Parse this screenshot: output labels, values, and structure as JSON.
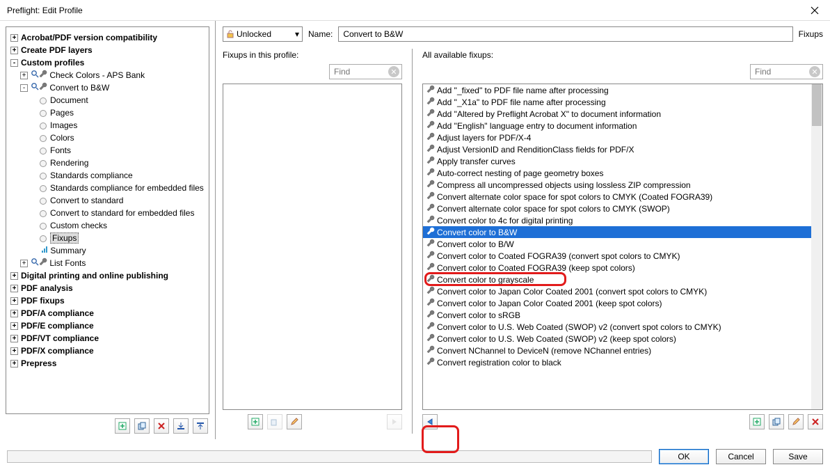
{
  "window": {
    "title": "Preflight: Edit Profile"
  },
  "tree": {
    "roots": [
      {
        "label": "Acrobat/PDF version compatibility",
        "exp": "+"
      },
      {
        "label": "Create PDF layers",
        "exp": "+"
      },
      {
        "label": "Custom profiles",
        "exp": "-",
        "children": [
          {
            "label": "Check Colors - APS Bank",
            "exp": "+",
            "type": "profile"
          },
          {
            "label": "Convert to B&W",
            "exp": "-",
            "type": "profile",
            "children": [
              {
                "label": "Document"
              },
              {
                "label": "Pages"
              },
              {
                "label": "Images"
              },
              {
                "label": "Colors"
              },
              {
                "label": "Fonts"
              },
              {
                "label": "Rendering"
              },
              {
                "label": "Standards compliance"
              },
              {
                "label": "Standards compliance for embedded files"
              },
              {
                "label": "Convert to standard"
              },
              {
                "label": "Convert to standard for embedded files"
              },
              {
                "label": "Custom checks"
              },
              {
                "label": "Fixups",
                "selected": true
              },
              {
                "label": "Summary",
                "icon": "summary"
              }
            ]
          },
          {
            "label": "List Fonts",
            "exp": "+",
            "type": "profile"
          }
        ]
      },
      {
        "label": "Digital printing and online publishing",
        "exp": "+"
      },
      {
        "label": "PDF analysis",
        "exp": "+"
      },
      {
        "label": "PDF fixups",
        "exp": "+"
      },
      {
        "label": "PDF/A compliance",
        "exp": "+"
      },
      {
        "label": "PDF/E compliance",
        "exp": "+"
      },
      {
        "label": "PDF/VT compliance",
        "exp": "+"
      },
      {
        "label": "PDF/X compliance",
        "exp": "+"
      },
      {
        "label": "Prepress",
        "exp": "+"
      }
    ]
  },
  "editor": {
    "lock_state": "Unlocked",
    "name_label": "Name:",
    "name_value": "Convert to B&W",
    "fixups_link": "Fixups",
    "left_panel_label": "Fixups in this profile:",
    "right_panel_label": "All available fixups:",
    "find_placeholder": "Find",
    "available": [
      "Add \"_fixed\" to PDF file name after processing",
      "Add \"_X1a\" to PDF file name after processing",
      "Add \"Altered by Preflight Acrobat X\" to document information",
      "Add \"English\" language entry to document information",
      "Adjust layers for PDF/X-4",
      "Adjust VersionID and RenditionClass fields for PDF/X",
      "Apply transfer curves",
      "Auto-correct nesting of page geometry boxes",
      "Compress all uncompressed objects using lossless ZIP compression",
      "Convert alternate color space for spot colors to CMYK (Coated FOGRA39)",
      "Convert alternate color space for spot colors to CMYK (SWOP)",
      "Convert color to 4c for digital printing",
      "Convert color to B&W",
      "Convert color to B/W",
      "Convert color to Coated FOGRA39 (convert spot colors to CMYK)",
      "Convert color to Coated FOGRA39 (keep spot colors)",
      "Convert color to grayscale",
      "Convert color to Japan Color Coated 2001 (convert spot colors to CMYK)",
      "Convert color to Japan Color Coated 2001 (keep spot colors)",
      "Convert color to sRGB",
      "Convert color to U.S. Web Coated (SWOP) v2  (convert spot colors to CMYK)",
      "Convert color to U.S. Web Coated (SWOP) v2 (keep spot colors)",
      "Convert NChannel to DeviceN (remove NChannel entries)",
      "Convert registration color to black"
    ],
    "selected_index": 12
  },
  "buttons": {
    "ok": "OK",
    "cancel": "Cancel",
    "save": "Save"
  }
}
